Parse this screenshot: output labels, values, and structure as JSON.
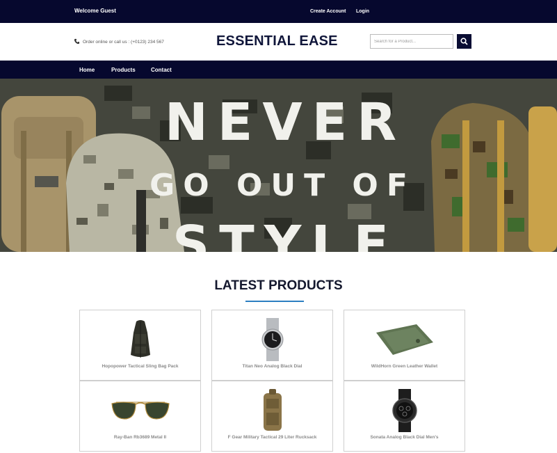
{
  "topbar": {
    "welcome": "Welcome Guest",
    "create_account": "Create Account",
    "login": "Login"
  },
  "header": {
    "order_text": "Order online or call us : (+0123) 234 567",
    "brand": "ESSENTIAL EASE",
    "search_placeholder": "Search for a Product...",
    "phone_icon": "phone-icon",
    "search_icon": "search-icon"
  },
  "nav": {
    "items": [
      {
        "label": "Home"
      },
      {
        "label": "Products"
      },
      {
        "label": "Contact"
      }
    ]
  },
  "hero": {
    "line1": "NEVER",
    "line2": "GO OUT OF",
    "line3": "STYLE"
  },
  "products": {
    "title": "LATEST PRODUCTS",
    "items": [
      {
        "name": "Hopopower Tactical Sling Bag Pack",
        "icon": "sling-bag-icon"
      },
      {
        "name": "Titan Neo Analog Black Dial",
        "icon": "watch-icon"
      },
      {
        "name": "WildHorn Green Leather Wallet",
        "icon": "wallet-icon"
      },
      {
        "name": "Ray-Ban Rb3689 Metal II",
        "icon": "sunglasses-icon"
      },
      {
        "name": "F Gear Military Tactical 29 Liter Rucksack",
        "icon": "rucksack-icon"
      },
      {
        "name": "Sonata Analog Black Dial Men's",
        "icon": "sport-watch-icon"
      }
    ]
  },
  "colors": {
    "navy": "#06082e",
    "accent_line": "#2d7fc1"
  }
}
